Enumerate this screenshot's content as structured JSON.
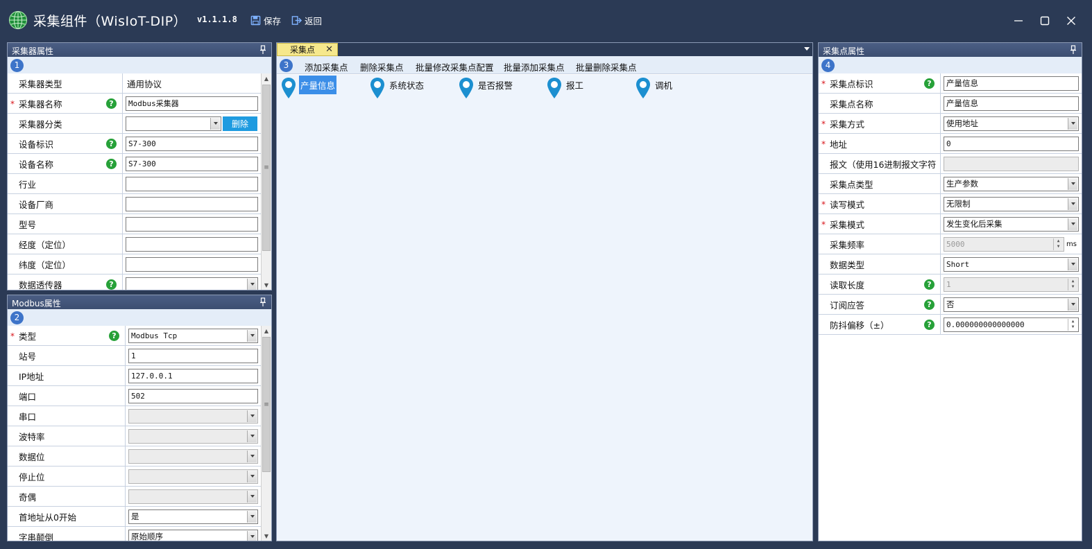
{
  "window": {
    "title": "采集组件（WisIoT-DIP）",
    "version": "v1.1.1.8",
    "save_label": "保存",
    "back_label": "返回"
  },
  "collector_panel": {
    "title": "采集器属性",
    "badge": "1",
    "rows": [
      {
        "label": "采集器类型",
        "required": false,
        "help": false,
        "value": "通用协议"
      },
      {
        "label": "采集器名称",
        "required": true,
        "help": true,
        "value": "Modbus采集器"
      },
      {
        "label": "采集器分类",
        "required": false,
        "help": false,
        "value": "",
        "button": "删除"
      },
      {
        "label": "设备标识",
        "required": false,
        "help": true,
        "value": "S7-300"
      },
      {
        "label": "设备名称",
        "required": false,
        "help": true,
        "value": "S7-300"
      },
      {
        "label": "行业",
        "required": false,
        "help": false,
        "value": ""
      },
      {
        "label": "设备厂商",
        "required": false,
        "help": false,
        "value": ""
      },
      {
        "label": "型号",
        "required": false,
        "help": false,
        "value": ""
      },
      {
        "label": "经度（定位）",
        "required": false,
        "help": false,
        "value": ""
      },
      {
        "label": "纬度（定位）",
        "required": false,
        "help": false,
        "value": ""
      },
      {
        "label": "数据透传器",
        "required": false,
        "help": true,
        "value": ""
      }
    ]
  },
  "modbus_panel": {
    "title": "Modbus属性",
    "badge": "2",
    "rows": [
      {
        "label": "类型",
        "required": true,
        "help": true,
        "value": "Modbus Tcp"
      },
      {
        "label": "站号",
        "required": false,
        "help": false,
        "value": "1"
      },
      {
        "label": "IP地址",
        "required": false,
        "help": false,
        "value": "127.0.0.1"
      },
      {
        "label": "端口",
        "required": false,
        "help": false,
        "value": "502"
      },
      {
        "label": "串口",
        "required": false,
        "help": false,
        "value": ""
      },
      {
        "label": "波特率",
        "required": false,
        "help": false,
        "value": ""
      },
      {
        "label": "数据位",
        "required": false,
        "help": false,
        "value": ""
      },
      {
        "label": "停止位",
        "required": false,
        "help": false,
        "value": ""
      },
      {
        "label": "奇偶",
        "required": false,
        "help": false,
        "value": ""
      },
      {
        "label": "首地址从0开始",
        "required": false,
        "help": false,
        "value": "是"
      },
      {
        "label": "字串颠倒",
        "required": false,
        "help": false,
        "value": "原始顺序"
      }
    ]
  },
  "points_panel": {
    "tab_label": "采集点",
    "tab_close": "✕",
    "badge": "3",
    "toolbar": [
      "添加采集点",
      "删除采集点",
      "批量修改采集点配置",
      "批量添加采集点",
      "批量删除采集点"
    ],
    "points": [
      "产量信息",
      "系统状态",
      "是否报警",
      "报工",
      "调机"
    ],
    "selected_point": "产量信息"
  },
  "point_props_panel": {
    "title": "采集点属性",
    "badge": "4",
    "rows": [
      {
        "label": "采集点标识",
        "required": true,
        "help": true,
        "value": "产量信息"
      },
      {
        "label": "采集点名称",
        "required": false,
        "help": false,
        "value": "产量信息"
      },
      {
        "label": "采集方式",
        "required": true,
        "help": false,
        "value": "使用地址"
      },
      {
        "label": "地址",
        "required": true,
        "help": false,
        "value": "0"
      },
      {
        "label": "报文（使用16进制报文字符",
        "required": false,
        "help": false,
        "value": ""
      },
      {
        "label": "采集点类型",
        "required": false,
        "help": false,
        "value": "生产参数"
      },
      {
        "label": "读写模式",
        "required": true,
        "help": false,
        "value": "无限制"
      },
      {
        "label": "采集模式",
        "required": true,
        "help": false,
        "value": "发生变化后采集"
      },
      {
        "label": "采集频率",
        "required": false,
        "help": false,
        "value": "5000",
        "unit": "ms"
      },
      {
        "label": "数据类型",
        "required": false,
        "help": false,
        "value": "Short"
      },
      {
        "label": "读取长度",
        "required": false,
        "help": true,
        "value": "1"
      },
      {
        "label": "订阅应答",
        "required": false,
        "help": true,
        "value": "否"
      },
      {
        "label": "防抖偏移（±）",
        "required": false,
        "help": true,
        "value": "0.000000000000000"
      }
    ]
  },
  "colors": {
    "chrome": "#2b3a55",
    "panel_header": "#4b5e84",
    "accent_blue": "#1e9be0",
    "pin_blue": "#1c8fd0",
    "help_green": "#27a139",
    "required_red": "#d8141a",
    "tab_yellow": "#f6e88c"
  },
  "icons": {
    "logo": "globe-icon",
    "save": "floppy-icon",
    "back": "exit-arrow-icon",
    "pin": "pin-icon",
    "point": "location-pin-icon",
    "help": "question-icon"
  }
}
